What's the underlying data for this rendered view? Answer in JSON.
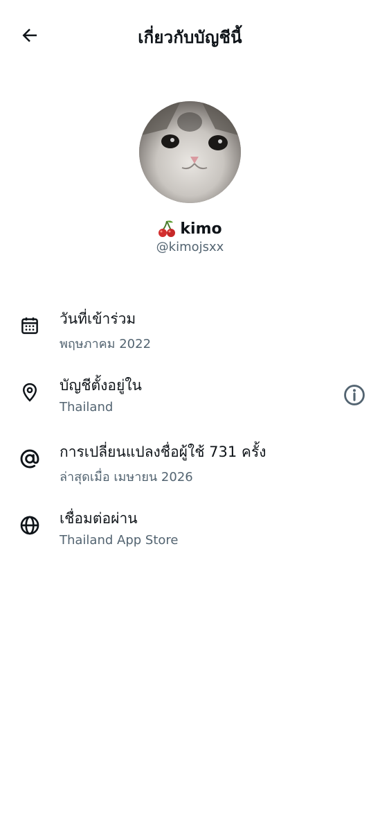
{
  "header": {
    "title": "เกี่ยวกับบัญชีนี้",
    "back_icon": "arrow-left-icon"
  },
  "profile": {
    "emoji": "🍒",
    "emoji_icon": "cherry-icon",
    "display_name": "kimo",
    "handle": "@kimojsxx"
  },
  "items": [
    {
      "icon": "calendar-icon",
      "title": "วันที่เข้าร่วม",
      "subtitle": "พฤษภาคม 2022"
    },
    {
      "icon": "location-pin-icon",
      "title": "บัญชีตั้งอยู่ใน",
      "subtitle": "Thailand",
      "action_icon": "info-circle-icon"
    },
    {
      "icon": "at-sign-icon",
      "title": "การเปลี่ยนแปลงชื่อผู้ใช้ 731 ครั้ง",
      "subtitle": "ล่าสุดเมื่อ เมษายน 2026"
    },
    {
      "icon": "globe-icon",
      "title": "เชื่อมต่อผ่าน",
      "subtitle": "Thailand App Store"
    }
  ],
  "colors": {
    "text_primary": "#0f1419",
    "text_secondary": "#536471",
    "background": "#ffffff"
  }
}
